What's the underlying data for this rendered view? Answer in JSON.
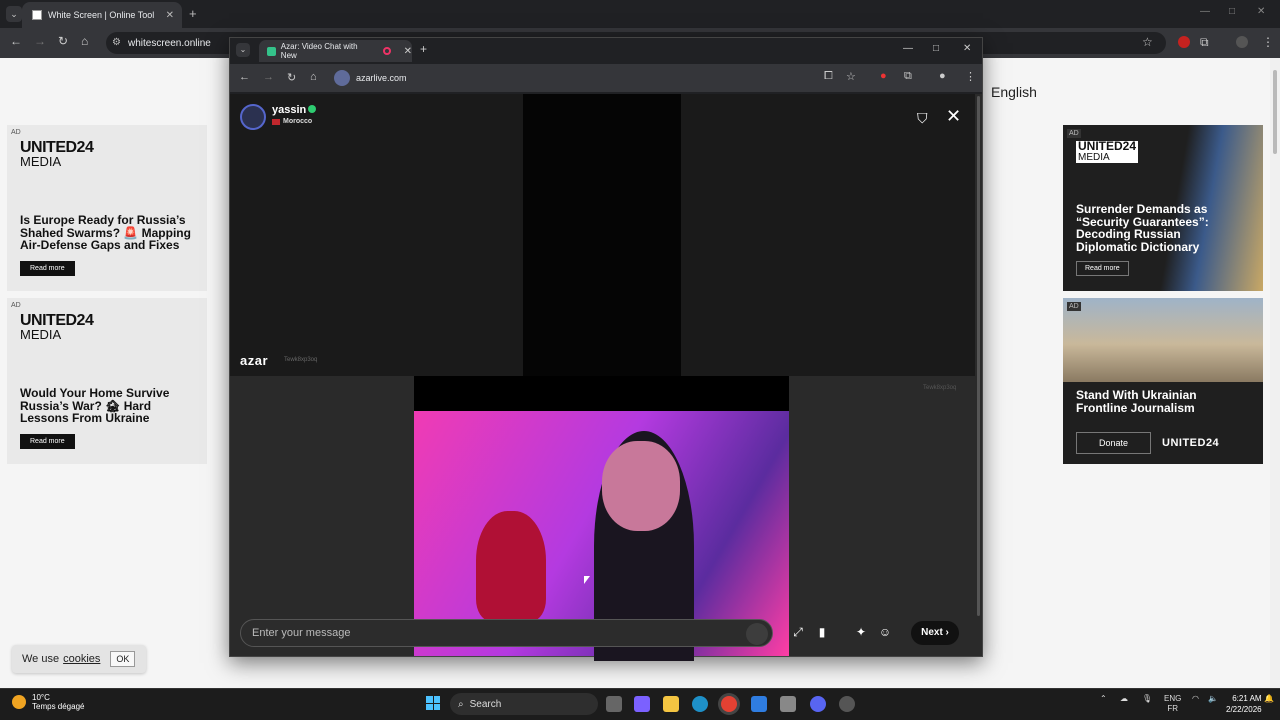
{
  "outer_browser": {
    "tab_title": "White Screen | Online Tool",
    "url": "whitescreen.online"
  },
  "page": {
    "language": "English",
    "left_ads": [
      {
        "tag": "AD",
        "brand": "UNITED24",
        "brand_sub": "MEDIA",
        "headline": "Is Europe Ready for Russia’s Shahed Swarms? 🚨 Mapping Air-Defense Gaps and Fixes",
        "button": "Read more"
      },
      {
        "tag": "AD",
        "brand": "UNITED24",
        "brand_sub": "MEDIA",
        "headline": "Would Your Home Survive Russia’s War? 🏚 Hard Lessons From Ukraine",
        "button": "Read more"
      }
    ],
    "right_ads": [
      {
        "tag": "AD",
        "brand": "UNITED24",
        "brand_sub": "MEDIA",
        "headline": "Surrender Demands as “Security Guarantees”: Decoding Russian Diplomatic Dictionary",
        "button": "Read more"
      },
      {
        "tag": "AD",
        "headline": "Stand With Ukrainian Frontline Journalism",
        "button": "Donate",
        "brand": "UNITED24"
      }
    ],
    "cookie": {
      "text": "We use",
      "link": "cookies",
      "ok": "OK"
    }
  },
  "inner_browser": {
    "tab_title": "Azar: Video Chat with New",
    "url": "azarlive.com"
  },
  "azar": {
    "user_name": "yassin",
    "country": "Morocco",
    "logo": "azar",
    "session_id": "Tewk8xp3oq",
    "message_placeholder": "Enter your message",
    "next_label": "Next ›"
  },
  "taskbar": {
    "temp": "10°C",
    "weather": "Temps dégagé",
    "search": "Search",
    "lang": "ENG",
    "lang_sub": "FR",
    "time": "6:21 AM",
    "date": "2/22/2026"
  },
  "colors": {
    "accent_green": "#34c28a",
    "ad_dark": "#1f1f1f",
    "cam_pink": "#f03bb4"
  }
}
